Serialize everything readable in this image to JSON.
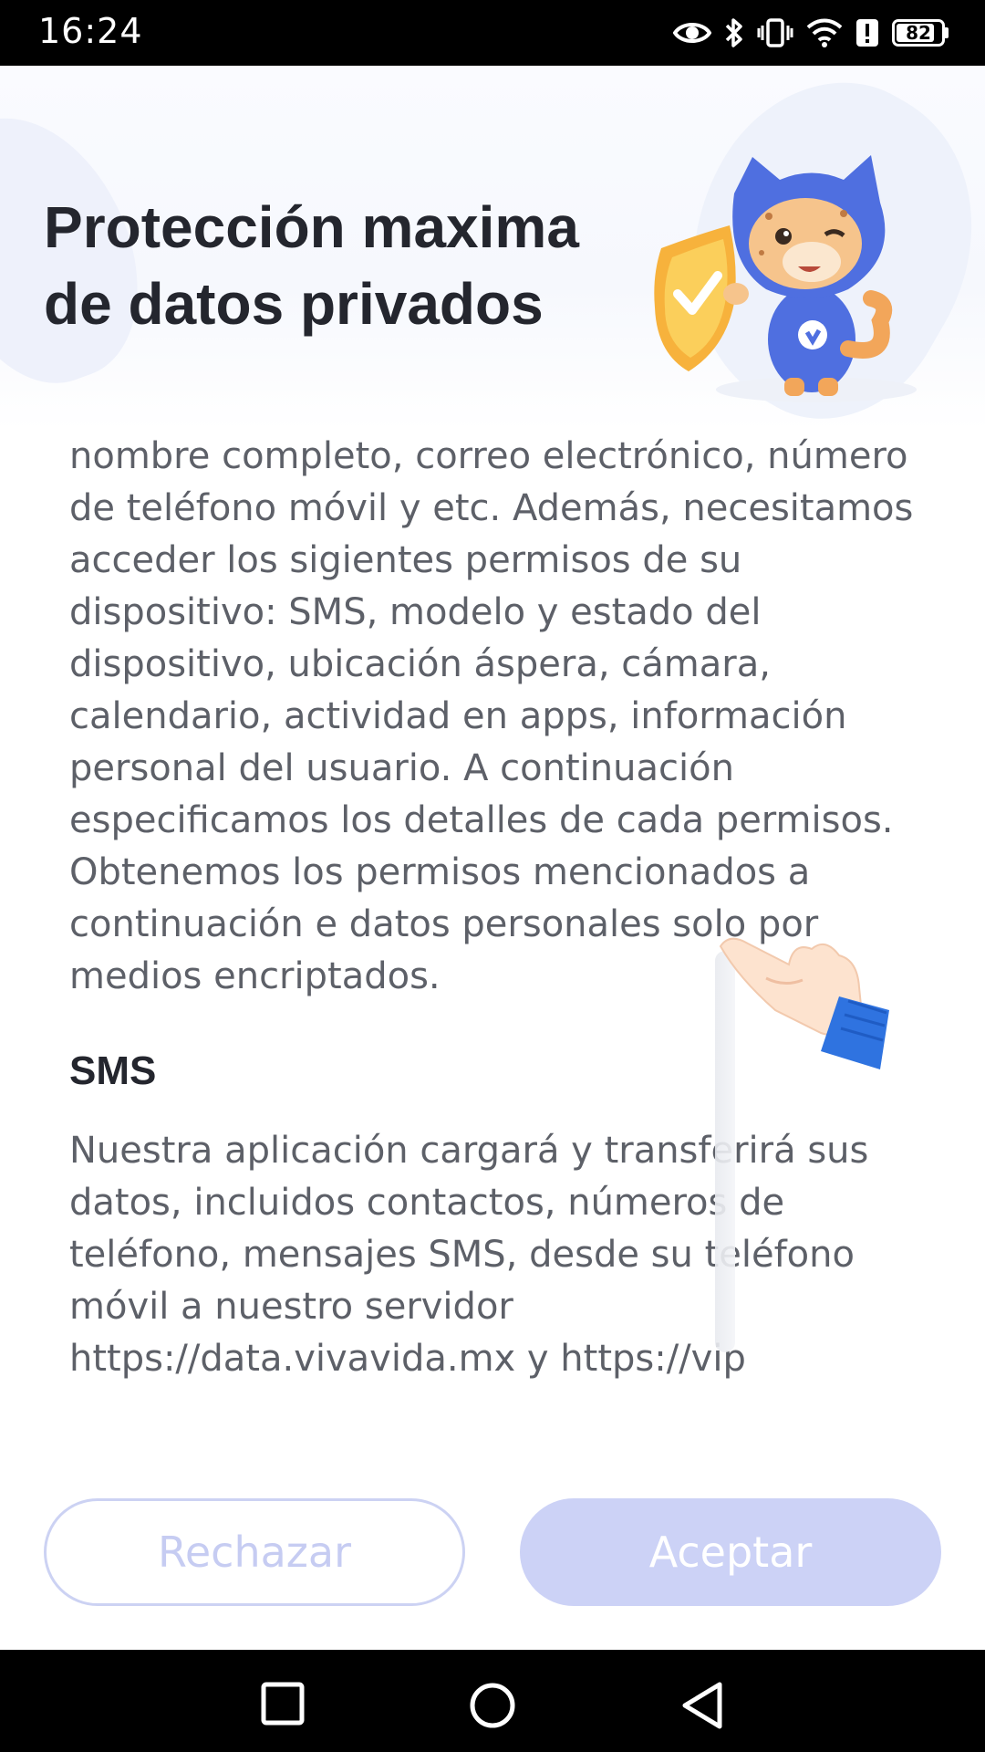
{
  "status_bar": {
    "time": "16:24",
    "icons": [
      "eye-icon",
      "bluetooth-icon",
      "vibrate-icon",
      "wifi-icon",
      "alert-icon",
      "battery-icon"
    ],
    "battery_level": "82"
  },
  "header": {
    "title_line1": "Protección maxima",
    "title_line2": "de datos privados"
  },
  "content": {
    "intro_paragraph": "nombre completo, correo electrónico, número de teléfono móvil y etc. Además, necesitamos acceder los sigientes permisos de su dispositivo: SMS, modelo y estado del dispositivo, ubicación áspera, cámara, calendario, actividad en apps, información personal del usuario. A continuación especificamos los detalles de cada permisos. Obtenemos los permisos mencionados a continuación e datos personales solo por medios encriptados.",
    "sms_heading": "SMS",
    "sms_paragraph": "Nuestra aplicación cargará y transferirá sus datos, incluidos contactos, números de teléfono, mensajes SMS, desde su teléfono móvil a nuestro servidor https://data.vivavida.mx y https://vip"
  },
  "actions": {
    "reject_label": "Rechazar",
    "accept_label": "Aceptar"
  },
  "nav_bar": {
    "icons": [
      "recent-apps-icon",
      "home-icon",
      "back-icon"
    ]
  },
  "colors": {
    "title": "#24262e",
    "body_text": "#5d6068",
    "button_accent": "#ccd2f6",
    "reject_text": "#c6ccf2"
  }
}
